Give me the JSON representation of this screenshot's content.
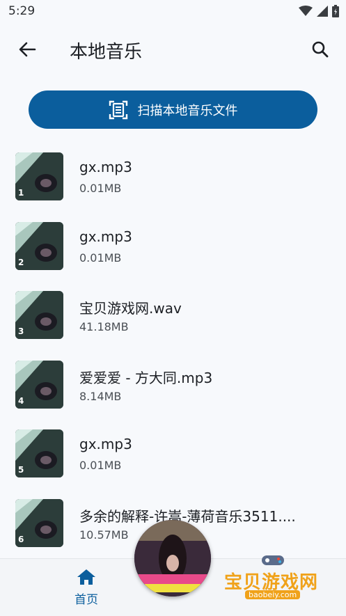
{
  "status_bar": {
    "time": "5:29"
  },
  "app_bar": {
    "title": "本地音乐"
  },
  "scan_button": {
    "label": "扫描本地音乐文件"
  },
  "songs": [
    {
      "index": "1",
      "title": "gx.mp3",
      "size": "0.01MB"
    },
    {
      "index": "2",
      "title": "gx.mp3",
      "size": "0.01MB"
    },
    {
      "index": "3",
      "title": "宝贝游戏网.wav",
      "size": "41.18MB"
    },
    {
      "index": "4",
      "title": "爱爱爱 - 方大同.mp3",
      "size": "8.14MB"
    },
    {
      "index": "5",
      "title": "gx.mp3",
      "size": "0.01MB"
    },
    {
      "index": "6",
      "title": "多余的解释-许嵩-薄荷音乐3511....",
      "size": "10.57MB"
    }
  ],
  "bottom_nav": {
    "home_label": "首页"
  },
  "watermark": {
    "main": "宝贝游戏网",
    "sub": "baobeiy.com"
  },
  "colors": {
    "primary": "#0b5e9d",
    "background": "#f7f9fc",
    "watermark": "#f0a21a"
  }
}
